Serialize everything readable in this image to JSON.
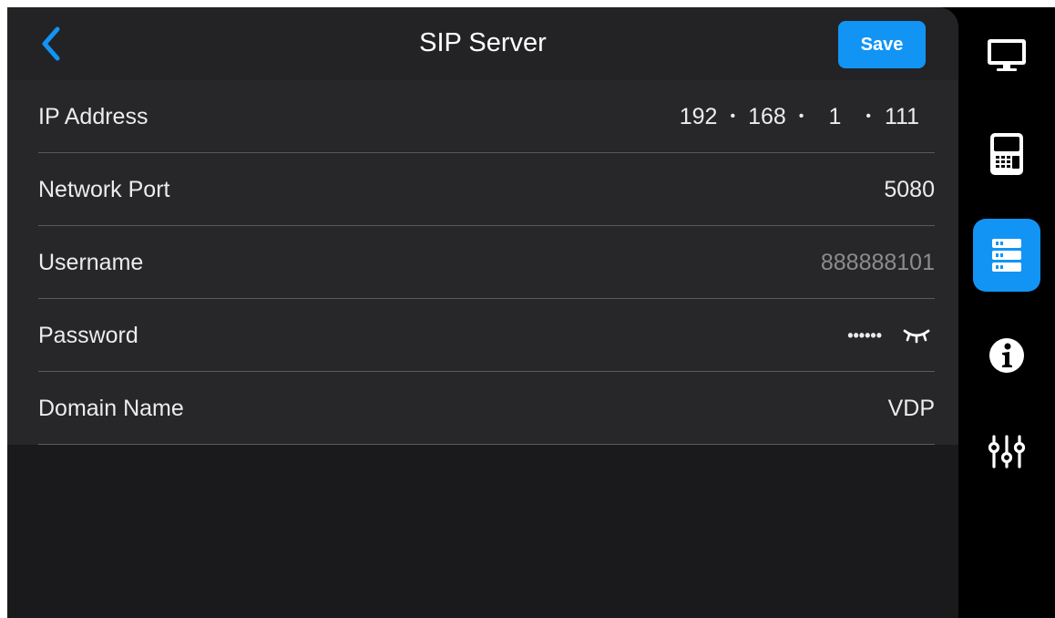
{
  "header": {
    "title": "SIP Server",
    "save_label": "Save"
  },
  "fields": {
    "ip": {
      "label": "IP Address",
      "octets": [
        "192",
        "168",
        "1",
        "111"
      ],
      "separator": "•"
    },
    "port": {
      "label": "Network Port",
      "value": "5080"
    },
    "username": {
      "label": "Username",
      "placeholder": "888888101"
    },
    "password": {
      "label": "Password",
      "mask": "••••••"
    },
    "domain": {
      "label": "Domain Name",
      "value": "VDP"
    }
  },
  "sidebar": {
    "items": [
      {
        "icon": "monitor-icon",
        "active": false
      },
      {
        "icon": "door-station-icon",
        "active": false
      },
      {
        "icon": "server-icon",
        "active": true
      },
      {
        "icon": "info-icon",
        "active": false
      },
      {
        "icon": "sliders-icon",
        "active": false
      }
    ]
  },
  "colors": {
    "accent": "#1294f5",
    "panel": "#27272a",
    "header": "#232325",
    "background": "#000000"
  }
}
